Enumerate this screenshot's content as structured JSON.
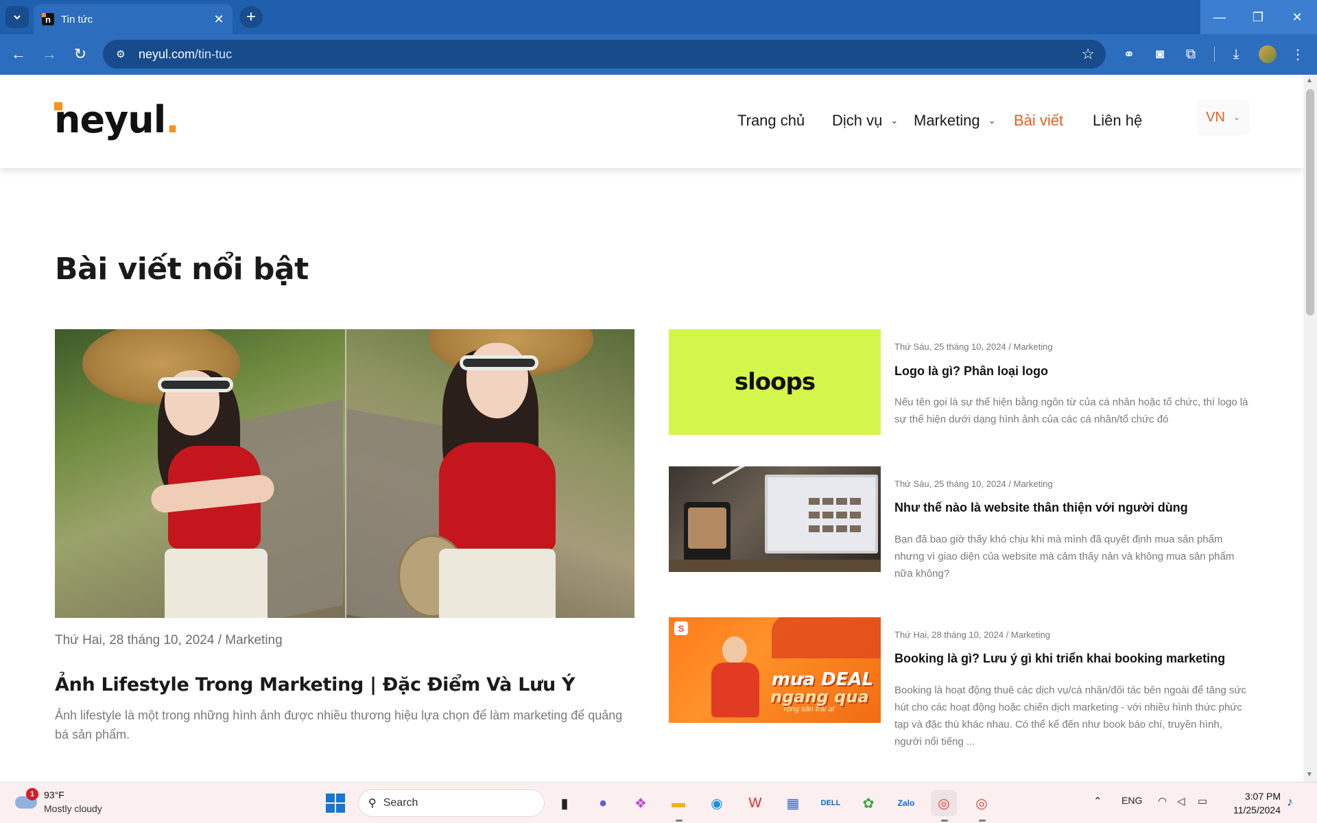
{
  "browser": {
    "tab_title": "Tin tức",
    "tab_favicon": "n",
    "url_host": "neyul.com",
    "url_path": "/tin-tuc",
    "icons": [
      "tab-search-icon",
      "close-icon",
      "plus-icon",
      "minimize-icon",
      "restore-icon",
      "close-window-icon",
      "back-icon",
      "forward-icon",
      "reload-icon",
      "site-info-icon",
      "star-icon",
      "extension-icon",
      "camera-icon",
      "puzzle-icon",
      "download-icon",
      "profile-avatar",
      "more-icon"
    ]
  },
  "site": {
    "logo_text": "neyul",
    "logo_dot": ".",
    "nav": [
      {
        "label": "Trang chủ"
      },
      {
        "label": "Dịch vụ"
      },
      {
        "label": "Marketing"
      },
      {
        "label": "Bài viết"
      },
      {
        "label": "Liên hệ"
      }
    ],
    "lang": "VN",
    "accent_color": "#e85d1e",
    "brand_color": "#f7931e"
  },
  "main": {
    "section_title": "Bài viết nổi bật",
    "featured": {
      "meta": "Thứ Hai, 28 tháng 10, 2024 / Marketing",
      "title": "Ảnh Lifestyle Trong Marketing | Đặc Điểm Và Lưu Ý",
      "desc": "Ảnh lifestyle là một trong những hình ảnh được nhiều thương hiệu lựa chọn để làm marketing để quảng bá sản phẩm."
    },
    "articles": [
      {
        "meta": "Thứ Sáu, 25 tháng 10, 2024 / Marketing",
        "title": "Logo là gì? Phân loại logo",
        "desc": "Nếu tên gọi là sự thể hiện bằng ngôn từ của cá nhân hoặc tổ chức, thì logo là sự thể hiện dưới dạng hình ảnh của các cá nhân/tổ chức đó",
        "thumb_text": "sloops"
      },
      {
        "meta": "Thứ Sáu, 25 tháng 10, 2024 / Marketing",
        "title": "Như thế nào là website thân thiện với người dùng",
        "desc": "Bạn đã bao giờ thấy khó chịu khi mà mình đã quyết định mua sản phẩm nhưng vì giao diện của website mà cảm thấy nản và không mua sản phẩm nữa không?"
      },
      {
        "meta": "Thứ Hai, 28 tháng 10, 2024 / Marketing",
        "title": "Booking là gì? Lưu ý gì khi triển khai booking marketing",
        "desc": "Booking là hoạt động thuê các dịch vụ/cá nhân/đối tác bên ngoài để tăng sức hút cho các hoạt động hoặc chiến dịch marketing -  với nhiều hình thức phức tạp và đặc thù khác nhau. Có thể kể đến như book báo chí, truyền hình, người nổi tiếng ...",
        "thumb_line1": "mưa DEAL",
        "thumb_line2": "ngang qua",
        "thumb_line3": "rộng săn trái ạt"
      }
    ]
  },
  "taskbar": {
    "weather_temp": "93°F",
    "weather_cond": "Mostly cloudy",
    "weather_badge": "1",
    "search_label": "Search",
    "lang": "ENG",
    "time": "3:07 PM",
    "date": "11/25/2024"
  }
}
